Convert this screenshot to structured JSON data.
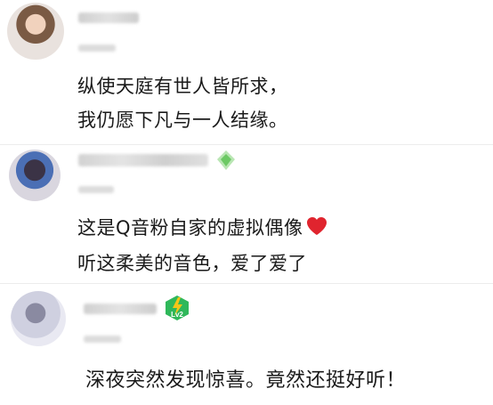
{
  "comments": [
    {
      "lines": [
        "纵使天庭有世人皆所求，",
        "我仍愿下凡与一人结缘。"
      ]
    },
    {
      "lines": [
        "这是Q音粉自家的虚拟偶像",
        "听这柔美的音色，爱了爱了"
      ],
      "emoji": "heart-emoji",
      "badge_icon": "green-diamond-icon"
    },
    {
      "lines": [
        "深夜突然发现惊喜。竟然还挺好听！"
      ],
      "badge": "Lv2",
      "badge_icon": "lightning-level-icon"
    }
  ],
  "colors": {
    "heart": "#e0242e",
    "level_green": "#2fb85a",
    "level_yellow": "#f5c518"
  }
}
